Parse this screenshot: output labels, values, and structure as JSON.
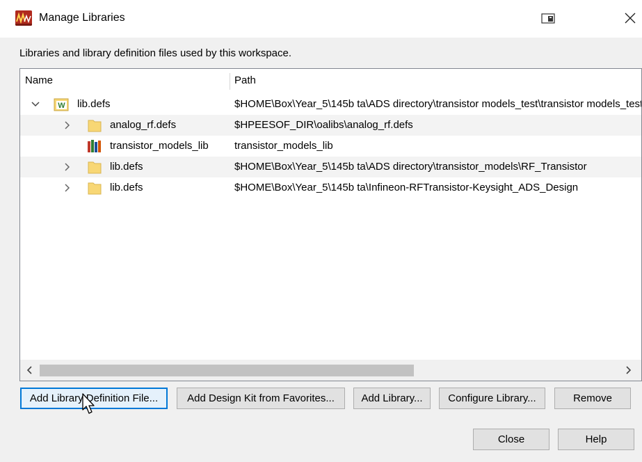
{
  "window": {
    "title": "Manage Libraries",
    "app_icon": "ads-app-icon",
    "controls": [
      "restore-icon",
      "close-icon"
    ]
  },
  "description": "Libraries and library definition files used by this workspace.",
  "tree": {
    "columns": {
      "name": "Name",
      "path": "Path"
    },
    "rows": [
      {
        "name": "lib.defs",
        "path": "$HOME\\Box\\Year_5\\145b ta\\ADS directory\\transistor models_test\\transistor models_test",
        "expanded": true,
        "icon": "workspace-folder-icon",
        "level": 0
      },
      {
        "name": "analog_rf.defs",
        "path": "$HPEESOF_DIR\\oalibs\\analog_rf.defs",
        "expanded": false,
        "icon": "folder-icon",
        "level": 1
      },
      {
        "name": "transistor_models_lib",
        "path": "transistor_models_lib",
        "icon": "library-books-icon",
        "level": 1
      },
      {
        "name": "lib.defs",
        "path": "$HOME\\Box\\Year_5\\145b ta\\ADS directory\\transistor_models\\RF_Transistor",
        "expanded": false,
        "icon": "folder-icon",
        "level": 1
      },
      {
        "name": "lib.defs",
        "path": "$HOME\\Box\\Year_5\\145b ta\\Infineon-RFTransistor-Keysight_ADS_Design",
        "expanded": false,
        "icon": "folder-icon",
        "level": 1
      }
    ],
    "scrollbar": {
      "left_arrow": "scroll-left-icon",
      "right_arrow": "scroll-right-icon",
      "position_fraction": 0.0,
      "visible_fraction": 0.62
    }
  },
  "buttons": {
    "add_def": "Add Library Definition File...",
    "add_kit": "Add Design Kit from Favorites...",
    "add_lib": "Add Library...",
    "configure": "Configure Library...",
    "remove": "Remove",
    "close": "Close",
    "help": "Help"
  },
  "colors": {
    "accent": "#0078d7",
    "dialog_bg": "#f0f0f0",
    "folder": "#f8d775",
    "workspace_w": "#2e7d32"
  }
}
